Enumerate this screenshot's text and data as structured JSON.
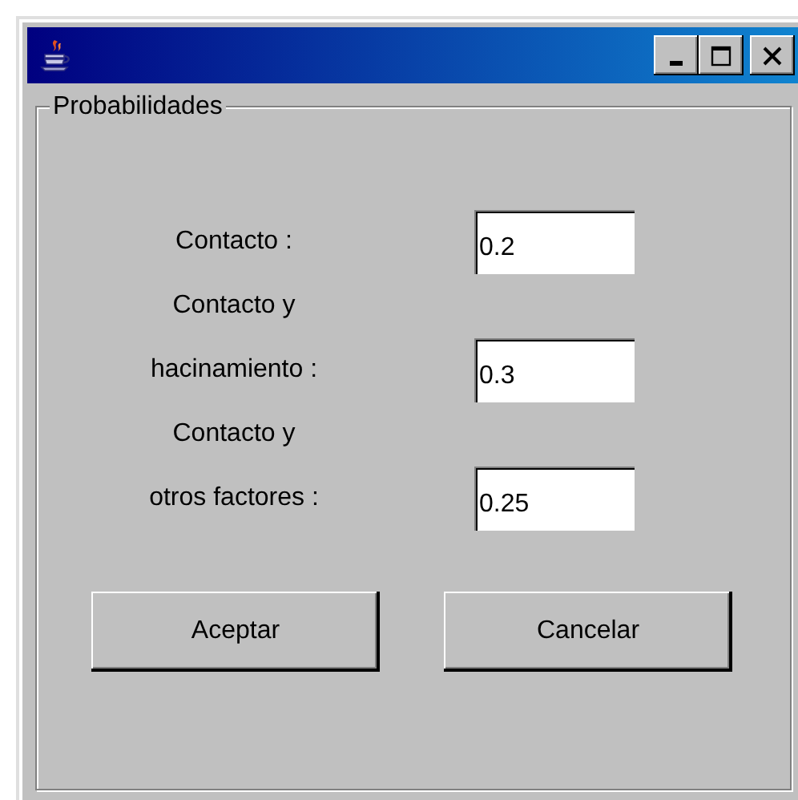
{
  "window": {
    "title_controls": [
      {
        "kind": "minimize"
      },
      {
        "kind": "maximize"
      },
      {
        "kind": "close"
      }
    ]
  },
  "group": {
    "title": "Probabilidades"
  },
  "fields": [
    {
      "label_lines": [
        "Contacto :"
      ],
      "value": "0.2"
    },
    {
      "label_lines": [
        "Contacto y",
        "hacinamiento :"
      ],
      "value": "0.3"
    },
    {
      "label_lines": [
        "Contacto y",
        "otros factores :"
      ],
      "value": "0.25"
    }
  ],
  "buttons": [
    "Aceptar",
    "Cancelar"
  ]
}
